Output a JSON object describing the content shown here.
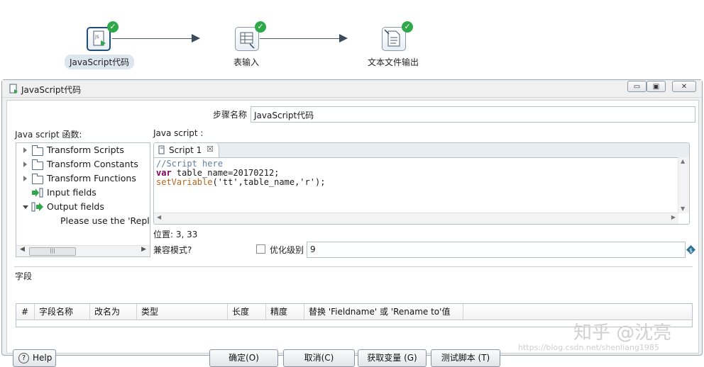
{
  "flow": {
    "steps": [
      {
        "label": "JavaScript代码",
        "status": "success",
        "selected": true
      },
      {
        "label": "表输入",
        "status": "success",
        "selected": false
      },
      {
        "label": "文本文件输出",
        "status": "success",
        "selected": false
      }
    ],
    "check_glyph": "✓"
  },
  "dialog": {
    "title": "JavaScript代码",
    "window_buttons": {
      "minimize": "▭",
      "restore": "▣",
      "close": "✕"
    },
    "step_name_label": "步骤名称",
    "step_name_value": "JavaScript代码",
    "functions_label": "Java script 函数:",
    "script_label": "Java script :",
    "tree": [
      {
        "label": "Transform Scripts",
        "icon": "folder-icon",
        "expanded": false
      },
      {
        "label": "Transform Constants",
        "icon": "folder-icon",
        "expanded": false
      },
      {
        "label": "Transform Functions",
        "icon": "folder-icon",
        "expanded": false
      },
      {
        "label": "Input fields",
        "icon": "input-fields-icon",
        "expanded": null
      },
      {
        "label": "Output fields",
        "icon": "output-fields-icon",
        "expanded": true
      },
      {
        "label": "Please use the 'Replac",
        "icon": null,
        "expanded": null
      }
    ],
    "tab_label": "Script 1",
    "tab_close": "☒",
    "code_lines": [
      {
        "parts": [
          {
            "t": "//Script here",
            "c": "comment"
          }
        ]
      },
      {
        "parts": [
          {
            "t": "var",
            "c": "kw"
          },
          {
            "t": " table_name=20170212;",
            "c": "plain"
          }
        ]
      },
      {
        "parts": [
          {
            "t": "setVariable",
            "c": "fn"
          },
          {
            "t": "('tt',table_name,'r');",
            "c": "plain"
          }
        ]
      }
    ],
    "position_label": "位置: 3, 33",
    "compat_label": "兼容模式?",
    "optimize_label": "优化级别",
    "optimize_value": "9",
    "fields_label": "字段",
    "table_headers": [
      "#",
      "字段名称",
      "改名为",
      "类型",
      "长度",
      "精度",
      "替换 'Fieldname' 或 'Rename to'值"
    ],
    "help_label": "Help",
    "buttons": {
      "ok": "确定(O)",
      "cancel": "取消(C)",
      "get_vars": "获取变量 (G)",
      "test_script": "测试脚本 (T)"
    }
  },
  "watermark": {
    "brand": "知乎 @沈亮",
    "url": "https://blog.csdn.net/shenliang1985"
  },
  "colors": {
    "success": "#2fa84a",
    "comment": "#5f7f9f",
    "keyword": "#7f0055",
    "function": "#b5651d"
  }
}
